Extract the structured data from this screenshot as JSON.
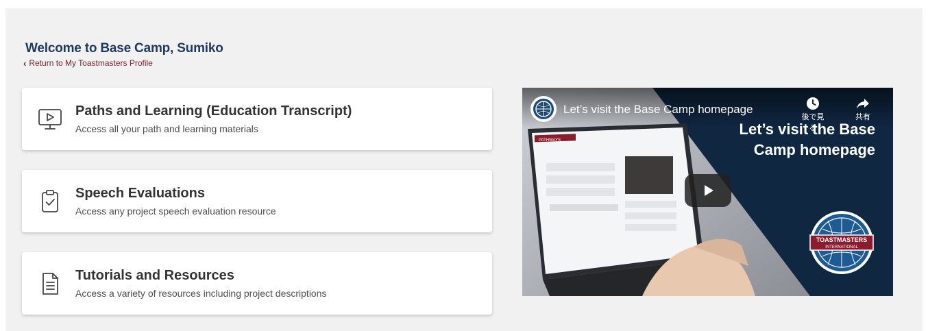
{
  "header": {
    "welcome": "Welcome to Base Camp, Sumiko",
    "return_link": "Return to My Toastmasters Profile"
  },
  "cards": [
    {
      "icon": "monitor-play-icon",
      "title": "Paths and Learning (Education Transcript)",
      "description": "Access all your path and learning materials"
    },
    {
      "icon": "clipboard-check-icon",
      "title": "Speech Evaluations",
      "description": "Access any project speech evaluation resource"
    },
    {
      "icon": "document-icon",
      "title": "Tutorials and Resources",
      "description": "Access a variety of resources including project descriptions"
    }
  ],
  "video": {
    "title": "Let’s visit the Base Camp homepage",
    "overlay_line1": "Let’s visit the Base",
    "overlay_line2": "Camp homepage",
    "watch_later": "後で見る",
    "share": "共有",
    "logo_text": "TOASTMASTERS",
    "logo_subtext": "INTERNATIONAL",
    "screen_brand": "PATHWAYS"
  },
  "colors": {
    "heading": "#1f3a5c",
    "link": "#7a1f2b",
    "video_bg": "#102742",
    "panel_bg": "#f1f1f1"
  }
}
